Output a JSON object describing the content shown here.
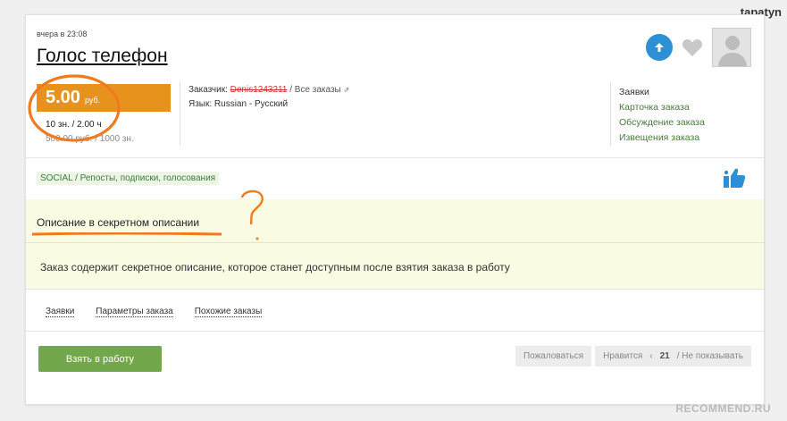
{
  "header": {
    "username": "tapatyn"
  },
  "order": {
    "time": "вчера в 23:08",
    "title": "Голос телефон",
    "price": {
      "value": "5.00",
      "currency": "руб.",
      "line1": "10 зн. / 2.00 ч",
      "line2": "500.00 руб. / 1000 зн."
    },
    "client": {
      "label": "Заказчик:",
      "name": "Denis1243211",
      "all_orders": "/ Все заказы"
    },
    "language": "Язык: Russian - Русский",
    "side_links": [
      "Заявки",
      "Карточка заказа",
      "Обсуждение заказа",
      "Извещения заказа"
    ],
    "category": "SOCIAL / Репосты, подписки, голосования",
    "secret": {
      "title": "Описание в секретном описании",
      "text": "Заказ содержит секретное описание, которое станет доступным после взятия заказа в работу"
    },
    "tabs": [
      "Заявки",
      "Параметры заказа",
      "Похожие заказы"
    ],
    "buttons": {
      "take": "Взять в работу",
      "complain": "Пожаловаться",
      "like": "Нравится",
      "like_count": "21",
      "hide": "/ Не показывать"
    }
  },
  "watermark": "RECOMMEND.RU",
  "colors": {
    "accent_orange": "#e8921e",
    "accent_green": "#72a84b",
    "up_blue": "#2d8fd6",
    "band_yellow": "#fafbe3"
  }
}
